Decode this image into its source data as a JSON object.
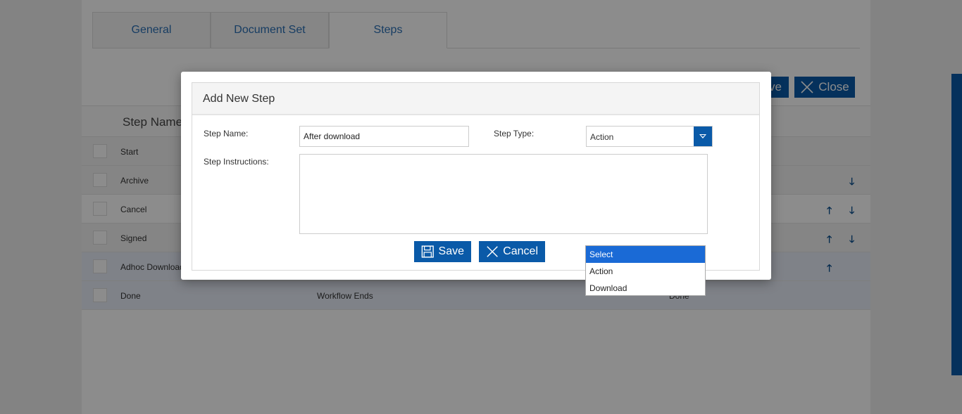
{
  "tabs": [
    {
      "label": "General"
    },
    {
      "label": "Document Set"
    },
    {
      "label": "Steps"
    }
  ],
  "toolbar": {
    "save_label": "Save",
    "close_label": "Close"
  },
  "table": {
    "header": "Step Name",
    "rows": [
      {
        "name": "Start",
        "description": "",
        "next": ""
      },
      {
        "name": "Archive",
        "description": "",
        "next": ""
      },
      {
        "name": "Cancel",
        "description": "",
        "next": ""
      },
      {
        "name": "Signed",
        "description": "",
        "next": ""
      },
      {
        "name": "Adhoc Download",
        "description": "",
        "next": ""
      },
      {
        "name": "Done",
        "description": "Workflow Ends",
        "next": "Done"
      }
    ]
  },
  "modal": {
    "title": "Add New Step",
    "step_name_label": "Step Name:",
    "step_name_value": "After download",
    "step_type_label": "Step Type:",
    "step_type_value": "Action",
    "instructions_label": "Step Instructions:",
    "instructions_value": "",
    "save_label": "Save",
    "cancel_label": "Cancel"
  },
  "dropdown": {
    "options": [
      "Select",
      "Action",
      "Download"
    ],
    "highlighted": "Select"
  },
  "colors": {
    "accent": "#0a5aa8",
    "highlight": "#1a6ad6"
  }
}
